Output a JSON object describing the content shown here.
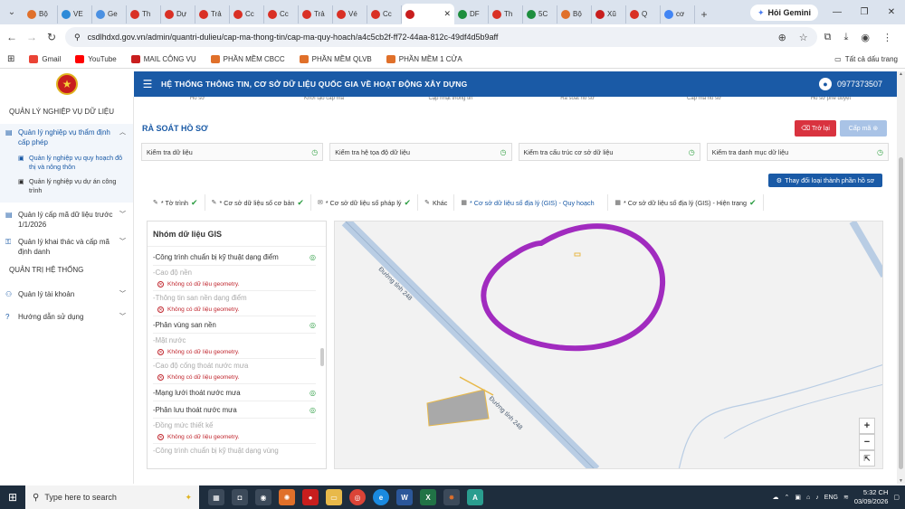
{
  "browser": {
    "tabs": [
      {
        "label": "Bộ",
        "color": "#e0702a"
      },
      {
        "label": "VE",
        "color": "#2c8ad8"
      },
      {
        "label": "Ge",
        "color": "#4a90e2"
      },
      {
        "label": "Th",
        "color": "#d93025"
      },
      {
        "label": "Dự",
        "color": "#d93025"
      },
      {
        "label": "Trả",
        "color": "#d93025"
      },
      {
        "label": "Cc",
        "color": "#d93025"
      },
      {
        "label": "Cc",
        "color": "#d93025"
      },
      {
        "label": "Trả",
        "color": "#d93025"
      },
      {
        "label": "Vé",
        "color": "#d93025"
      },
      {
        "label": "Cc",
        "color": "#d93025"
      }
    ],
    "active_tab": {
      "label": "",
      "color": "#c81e1e"
    },
    "tabs_after": [
      {
        "label": "DF",
        "color": "#1e8e3e"
      },
      {
        "label": "Th",
        "color": "#d93025"
      },
      {
        "label": "5C",
        "color": "#1e8e3e"
      },
      {
        "label": "Bộ",
        "color": "#e0702a"
      },
      {
        "label": "Xũ",
        "color": "#c81e1e"
      },
      {
        "label": "Q",
        "color": "#d93025"
      },
      {
        "label": "cơ",
        "color": "#4285f4"
      }
    ],
    "gemini_label": "Hỏi Gemini",
    "url": "csdlhdxd.gov.vn/admin/quantri-dulieu/cap-ma-thong-tin/cap-ma-quy-hoach/a4c5cb2f-ff72-44aa-812c-49df4d5b9aff",
    "bookmarks": [
      {
        "label": "Gmail",
        "color": "#ea4335"
      },
      {
        "label": "YouTube",
        "color": "#ff0000"
      },
      {
        "label": "MAIL CÔNG VỤ",
        "color": "#c81e1e"
      },
      {
        "label": "PHẦN MỀM CBCC",
        "color": "#e0702a"
      },
      {
        "label": "PHẦN MỀM QLVB",
        "color": "#e0702a"
      },
      {
        "label": "PHẦN MỀM 1 CỬA",
        "color": "#e0702a"
      }
    ],
    "all_bookmarks": "Tất cả dấu trang"
  },
  "header": {
    "title": "HỆ THỐNG THÔNG TIN, CƠ SỞ DỮ LIỆU QUỐC GIA VỀ HOẠT ĐỘNG XÂY DỰNG",
    "phone": "0977373507"
  },
  "sidebar": {
    "section1": "QUẢN LÝ NGHIỆP VỤ DỮ LIỆU",
    "item_thamdinh": "Quản lý nghiệp vụ thẩm định cấp phép",
    "sub_quyhoach": "Quản lý nghiệp vụ quy hoạch đô thị và nông thôn",
    "sub_duan": "Quản lý nghiệp vụ dự án công trình",
    "item_capma": "Quản lý cấp mã dữ liệu trước 1/1/2026",
    "item_khaithac": "Quản lý khai thác và cấp mã định danh",
    "section2": "QUẢN TRỊ HỆ THỐNG",
    "item_taikhoan": "Quản lý tài khoản",
    "item_huongdan": "Hướng dẫn sử dụng"
  },
  "steps": [
    "Hồ sơ",
    "Khởi tạo cấp mã",
    "Cập nhật thông tin",
    "Rà soát hồ sơ",
    "Cấp mã hồ sơ",
    "Hồ sơ phê duyệt"
  ],
  "main": {
    "title": "RÀ SOÁT HỒ SƠ",
    "back_label": "Trở lại",
    "capma_label": "Cấp mã",
    "checks": [
      "Kiểm tra dữ liệu",
      "Kiểm tra hệ tọa độ dữ liệu",
      "Kiểm tra cấu trúc cơ sở dữ liệu",
      "Kiểm tra danh mục dữ liệu"
    ],
    "change_label": "Thay đổi loại thành phần hồ sơ",
    "data_tabs": [
      {
        "label": "* Tờ trình",
        "ok": "✔"
      },
      {
        "label": "* Cơ sở dữ liệu số cơ bản",
        "ok": "✔"
      },
      {
        "label": "* Cơ sở dữ liệu số pháp lý",
        "ok": "✔"
      },
      {
        "label": "Khác",
        "ok": ""
      },
      {
        "label": "* Cơ sở dữ liệu số địa lý (GIS) - Quy hoạch",
        "ok": ""
      },
      {
        "label": "* Cơ sở dữ liệu số địa lý (GIS) - Hiện trạng",
        "ok": "✔"
      }
    ]
  },
  "gis": {
    "title": "Nhóm dữ liệu GIS",
    "error_text": "Không có dữ liệu geometry.",
    "items": {
      "i1": "Công trình chuẩn bị kỹ thuật dạng điểm",
      "i2": "Cao độ nền",
      "i3": "Thông tin san nền dạng điểm",
      "i4": "Phân vùng san nền",
      "i5": "Mặt nước",
      "i6": "Cao độ cống thoát nước mưa",
      "i7": "Mạng lưới thoát nước mưa",
      "i8": "Phân lưu thoát nước mưa",
      "i9": "Đồng mức thiết kế",
      "i10": "Công trình chuẩn bị kỹ thuật dạng vùng"
    }
  },
  "map": {
    "road_label": "Đường tỉnh 248",
    "zoom_in": "+",
    "zoom_out": "−",
    "reset": "⇱"
  },
  "taskbar": {
    "search_placeholder": "Type here to search",
    "lang": "ENG",
    "time": "5:32 CH",
    "date": "03/09/2026"
  }
}
